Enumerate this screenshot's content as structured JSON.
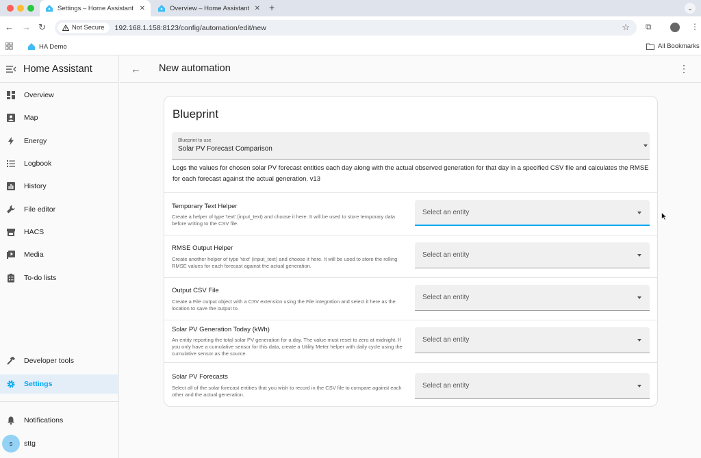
{
  "browser": {
    "tabs": [
      {
        "title": "Settings – Home Assistant",
        "active": true
      },
      {
        "title": "Overview – Home Assistant",
        "active": false
      }
    ],
    "security_label": "Not Secure",
    "url": "192.168.1.158:8123/config/automation/edit/new",
    "bookmark": "HA Demo",
    "all_bookmarks": "All Bookmarks"
  },
  "sidebar": {
    "title": "Home Assistant",
    "items": [
      {
        "label": "Overview",
        "icon": "dashboard-icon"
      },
      {
        "label": "Map",
        "icon": "map-icon"
      },
      {
        "label": "Energy",
        "icon": "lightning-icon"
      },
      {
        "label": "Logbook",
        "icon": "list-icon"
      },
      {
        "label": "History",
        "icon": "chart-icon"
      },
      {
        "label": "File editor",
        "icon": "wrench-icon"
      },
      {
        "label": "HACS",
        "icon": "hacs-icon"
      },
      {
        "label": "Media",
        "icon": "media-icon"
      },
      {
        "label": "To-do lists",
        "icon": "clipboard-icon"
      }
    ],
    "bottom_items": [
      {
        "label": "Developer tools",
        "icon": "hammer-icon"
      },
      {
        "label": "Settings",
        "icon": "gear-icon",
        "selected": true
      }
    ],
    "notifications": "Notifications",
    "user": {
      "initial": "s",
      "name": "sttg"
    }
  },
  "header": {
    "title": "New automation"
  },
  "blueprint": {
    "card_title": "Blueprint",
    "select_label": "Blueprint to use",
    "select_value": "Solar PV Forecast Comparison",
    "description": "Logs the values for chosen solar PV forecast entities each day along with the actual observed generation for that day in a specified CSV file and calculates the RMSE for each forecast against the actual generation. v13"
  },
  "inputs": [
    {
      "name": "Temporary Text Helper",
      "description": "Create a helper of type 'text' (input_text) and choose it here. It will be used to store temporary data before writing to the CSV file.",
      "placeholder": "Select an entity"
    },
    {
      "name": "RMSE Output Helper",
      "description": "Create another helper of type 'text' (input_text) and choose it here. It will be used to store the rolling RMSE values for each forecast against the actual generation.",
      "placeholder": "Select an entity"
    },
    {
      "name": "Output CSV File",
      "description": "Create a File output object with a CSV extension using the File integration and select it here as the location to save the output to.",
      "placeholder": "Select an entity"
    },
    {
      "name": "Solar PV Generation Today (kWh)",
      "description": "An entity reporting the total solar PV generation for a day. The value must reset to zero at midnight. If you only have a cumulative sensor for this data, create a Utility Meter helper with daily cycle using the cumulative sensor as the source.",
      "placeholder": "Select an entity"
    },
    {
      "name": "Solar PV Forecasts",
      "description": "Select all of the solar forecast entities that you wish to record in the CSV file to compare against each other and the actual generation.",
      "placeholder": "Select an entity"
    }
  ],
  "colors": {
    "accent": "#03a9f4",
    "sidebar_selected_bg": "#e3eef9"
  }
}
